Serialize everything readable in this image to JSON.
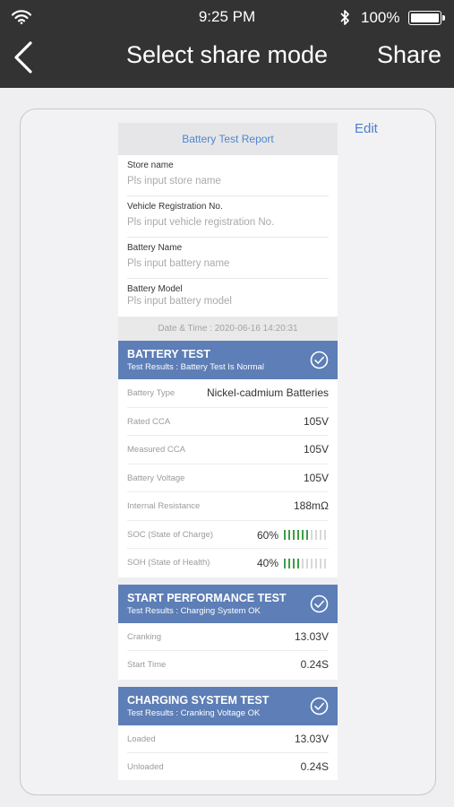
{
  "status": {
    "time": "9:25 PM",
    "battery_pct": "100%"
  },
  "nav": {
    "title": "Select share mode",
    "share_label": "Share"
  },
  "edit_label": "Edit",
  "report": {
    "title": "Battery Test Report",
    "fields": [
      {
        "label": "Store name",
        "placeholder": "Pls input store name"
      },
      {
        "label": "Vehicle Registration No.",
        "placeholder": "Pls input vehicle registration No."
      },
      {
        "label": "Battery Name",
        "placeholder": "Pls input battery name"
      },
      {
        "label": "Battery Model",
        "placeholder": "Pls input battery model"
      }
    ],
    "datetime": "Date & Time : 2020-06-16 14:20:31",
    "battery_test": {
      "title": "BATTERY TEST",
      "subtitle": "Test Results : Battery Test Is Normal",
      "rows": [
        {
          "key": "Battery Type",
          "value": "Nickel-cadmium Batteries"
        },
        {
          "key": "Rated CCA",
          "value": "105V"
        },
        {
          "key": "Measured CCA",
          "value": "105V"
        },
        {
          "key": "Battery Voltage",
          "value": "105V"
        },
        {
          "key": "Internal Resistance",
          "value": "188mΩ"
        }
      ],
      "soc": {
        "key": "SOC (State of Charge)",
        "value": "60%",
        "level": 0.6
      },
      "soh": {
        "key": "SOH (State of Health)",
        "value": "40%",
        "level": 0.4
      }
    },
    "start_test": {
      "title": "START PERFORMANCE TEST",
      "subtitle": "Test Results : Charging System OK",
      "rows": [
        {
          "key": "Cranking",
          "value": "13.03V"
        },
        {
          "key": "Start Time",
          "value": "0.24S"
        }
      ]
    },
    "charging_test": {
      "title": "CHARGING SYSTEM TEST",
      "subtitle": "Test Results : Cranking Voltage OK",
      "rows": [
        {
          "key": "Loaded",
          "value": "13.03V"
        },
        {
          "key": "Unloaded",
          "value": "0.24S"
        }
      ]
    }
  }
}
